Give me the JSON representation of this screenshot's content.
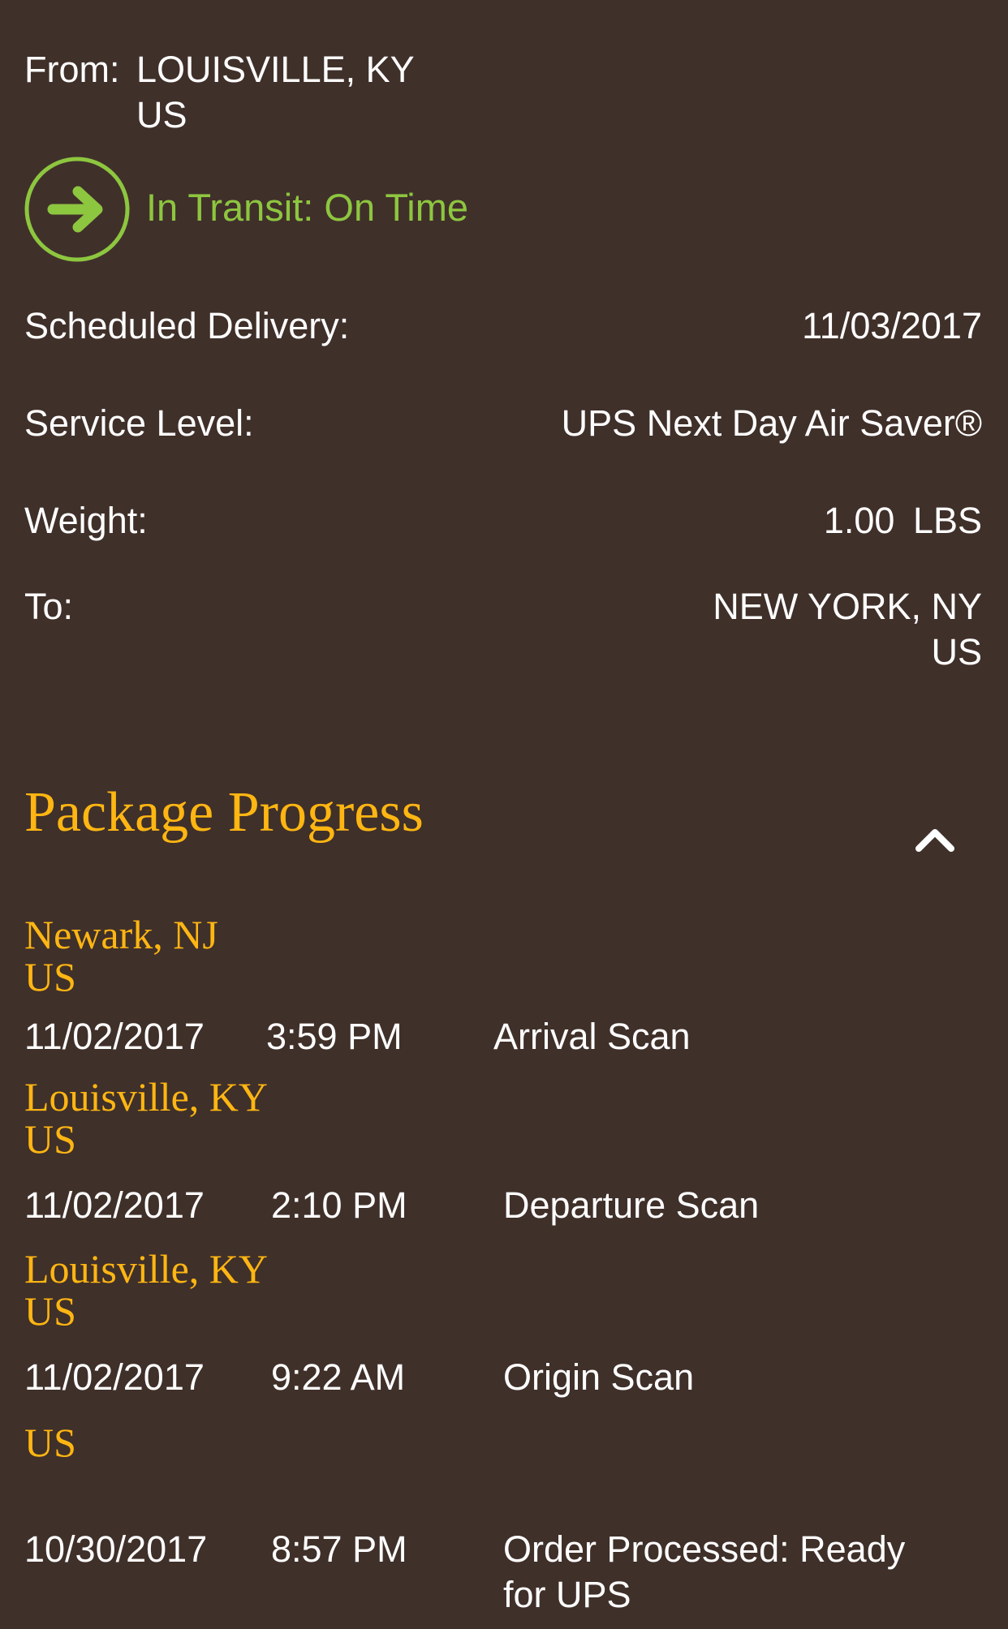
{
  "shipment": {
    "from_label": "From:",
    "from_line1": "LOUISVILLE, KY",
    "from_line2": "US",
    "status_icon": "arrow-right-circle-icon",
    "status_text": "In Transit: On Time",
    "status_color": "#8dc63f",
    "scheduled_label": "Scheduled Delivery:",
    "scheduled_value": "11/03/2017",
    "service_label": "Service Level:",
    "service_value": "UPS Next Day Air Saver®",
    "weight_label": "Weight:",
    "weight_value": "1.00",
    "weight_unit": "LBS",
    "to_label": "To:",
    "to_line1": "NEW YORK, NY",
    "to_line2": "US"
  },
  "progress": {
    "title": "Package Progress",
    "collapse_icon": "chevron-up-icon",
    "accent_color": "#ffb612",
    "events": [
      {
        "location_line1": "Newark, NJ",
        "location_line2": "US",
        "date": "11/02/2017",
        "time": "3:59 PM",
        "activity": "Arrival Scan"
      },
      {
        "location_line1": "Louisville, KY",
        "location_line2": "US",
        "date": "11/02/2017",
        "time": "2:10 PM",
        "activity": "Departure Scan"
      },
      {
        "location_line1": "Louisville, KY",
        "location_line2": "US",
        "date": "11/02/2017",
        "time": "9:22 AM",
        "activity": "Origin Scan"
      },
      {
        "location_line1": "US",
        "date": "10/30/2017",
        "time": "8:57 PM",
        "activity_line1": "Order Processed: Ready",
        "activity_line2": "for UPS"
      }
    ]
  }
}
